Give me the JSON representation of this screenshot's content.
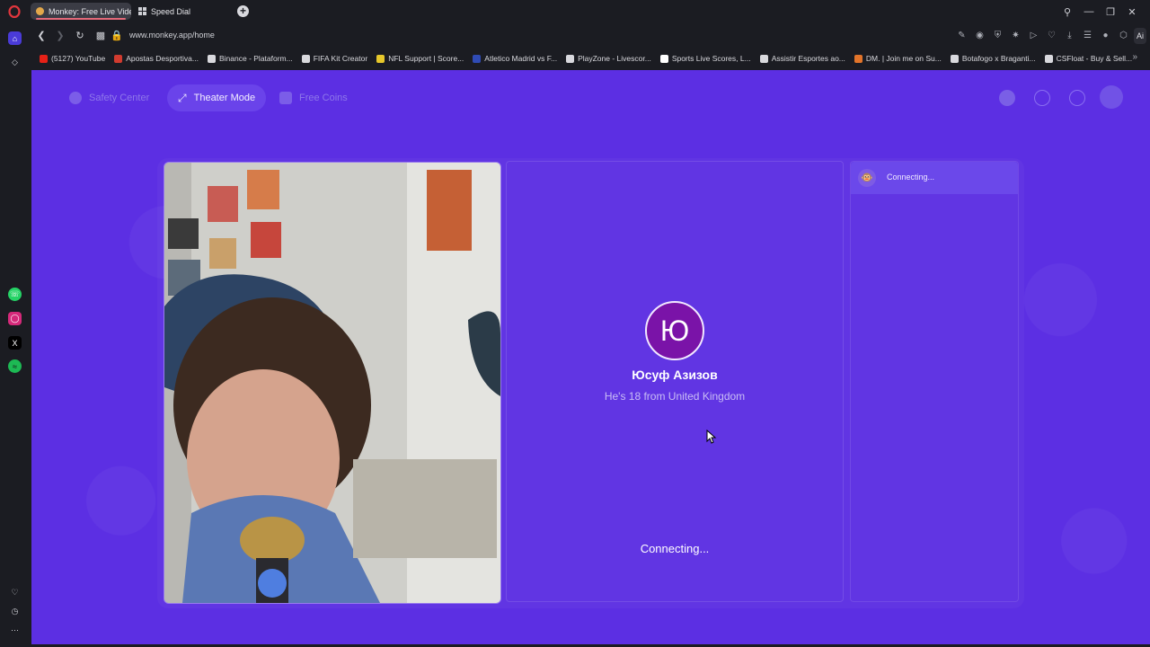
{
  "browser": {
    "tabs": [
      {
        "label": "Monkey: Free Live Video C",
        "active": true
      },
      {
        "label": "Speed Dial",
        "active": false
      }
    ],
    "url": "www.monkey.app/home",
    "ai_button": "Ai",
    "bookmarks": [
      {
        "label": "(5127) YouTube",
        "color": "#e62117"
      },
      {
        "label": "Apostas Desportiva...",
        "color": "#d13b2f"
      },
      {
        "label": "Binance - Plataform...",
        "color": "#d9d9de"
      },
      {
        "label": "FIFA Kit Creator",
        "color": "#d9d9de"
      },
      {
        "label": "NFL Support | Score...",
        "color": "#e6c72b"
      },
      {
        "label": "Atletico Madrid vs F...",
        "color": "#2f4bb5"
      },
      {
        "label": "PlayZone - Livescor...",
        "color": "#d9d9de"
      },
      {
        "label": "Sports Live Scores, L...",
        "color": "#ffffff"
      },
      {
        "label": "Assistir Esportes ao...",
        "color": "#d9d9de"
      },
      {
        "label": "DM. | Join me on Su...",
        "color": "#e2742a"
      },
      {
        "label": "Botafogo x Braganti...",
        "color": "#d9d9de"
      },
      {
        "label": "CSFloat - Buy & Sell...",
        "color": "#d9d9de"
      }
    ]
  },
  "page": {
    "nav": {
      "safety_center": "Safety Center",
      "theater_mode": "Theater Mode",
      "free_coins": "Free Coins"
    },
    "remote": {
      "avatar_letter": "Ю",
      "name": "Юсуф Азизов",
      "subtitle": "He's 18 from United Kingdom",
      "status": "Connecting..."
    },
    "chat": {
      "status": "Connecting...",
      "icon": "🐵"
    },
    "colors": {
      "background": "#5c2fe3",
      "avatar": "#7a13a8"
    }
  }
}
